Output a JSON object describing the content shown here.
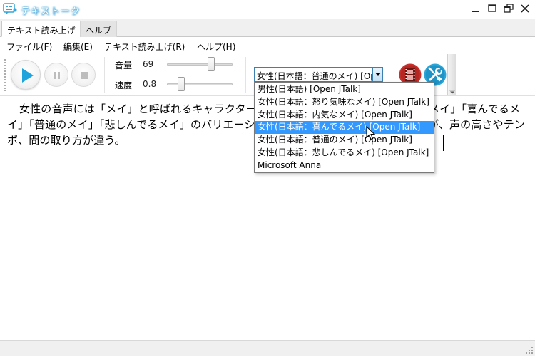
{
  "window": {
    "title": "テキストーク"
  },
  "tabs": [
    {
      "label": "テキスト読み上げ",
      "active": true
    },
    {
      "label": "ヘルプ",
      "active": false
    }
  ],
  "menu": [
    {
      "label": "ファイル(F)"
    },
    {
      "label": "編集(E)"
    },
    {
      "label": "テキスト読み上げ(R)"
    },
    {
      "label": "ヘルプ(H)"
    }
  ],
  "toolbar": {
    "volume": {
      "label": "音量",
      "value": "69",
      "fraction": 0.69
    },
    "speed": {
      "label": "速度",
      "value": "0.8",
      "fraction": 0.18
    },
    "voice_selected": "女性(日本語：普通のメイ) [Open JTalk]"
  },
  "voice_options": [
    {
      "label": "男性(日本語) [Open JTalk]",
      "highlighted": false
    },
    {
      "label": "女性(日本語：怒り気味なメイ) [Open JTalk]",
      "highlighted": false
    },
    {
      "label": "女性(日本語：内気なメイ) [Open JTalk]",
      "highlighted": false
    },
    {
      "label": "女性(日本語：喜んでるメイ) [Open JTalk]",
      "highlighted": true
    },
    {
      "label": "女性(日本語：普通のメイ) [Open JTalk]",
      "highlighted": false
    },
    {
      "label": "女性(日本語：悲しんでるメイ) [Open JTalk]",
      "highlighted": false
    },
    {
      "label": "Microsoft Anna",
      "highlighted": false
    }
  ],
  "editor": {
    "text": "女性の音声には「メイ」と呼ばれるキャラクターがいて、「怒り気味なメイ」「内気なメイ」「喜んでるメイ」「普通のメイ」「悲しんでるメイ」のバリエーションがある。いずれも声質は同じだが、声の高さやテンポ、間の取り方が違う。"
  },
  "colors": {
    "accent": "#3399ff",
    "title_glow": "#4aa8d8",
    "play_icon": "#1fa3dc",
    "wrench_icon": "#2ba6d8",
    "film_icon": "#c9302c"
  }
}
